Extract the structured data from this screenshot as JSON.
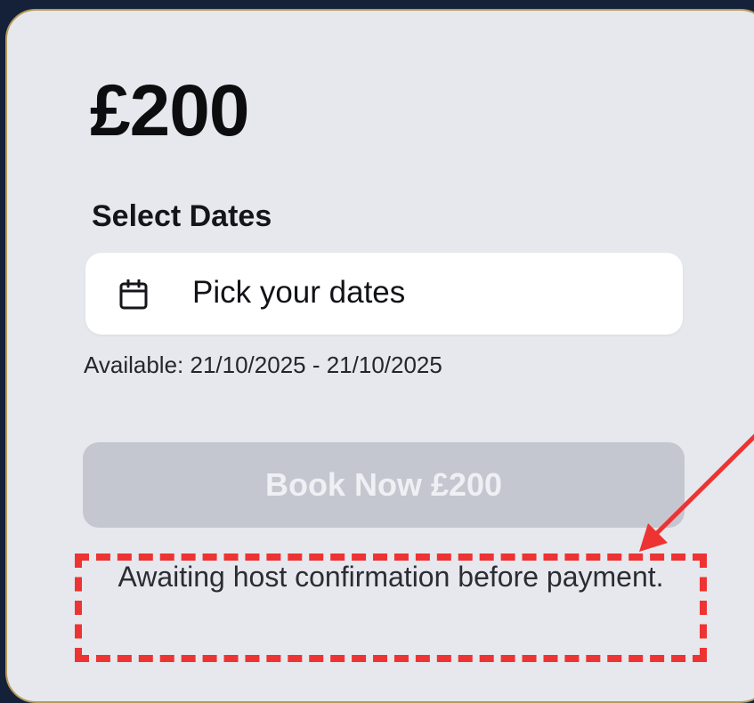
{
  "card": {
    "price": "£200",
    "select_dates_label": "Select Dates",
    "date_picker": {
      "icon": "calendar-icon",
      "placeholder": "Pick your dates"
    },
    "availability": "Available: 21/10/2025 - 21/10/2025",
    "book_button": {
      "label": "Book Now £200",
      "disabled": true
    },
    "notice": "Awaiting host confirmation before payment."
  },
  "annotation": {
    "color": "#ee3333",
    "style": "dashed box with arrow",
    "target": "notice"
  }
}
